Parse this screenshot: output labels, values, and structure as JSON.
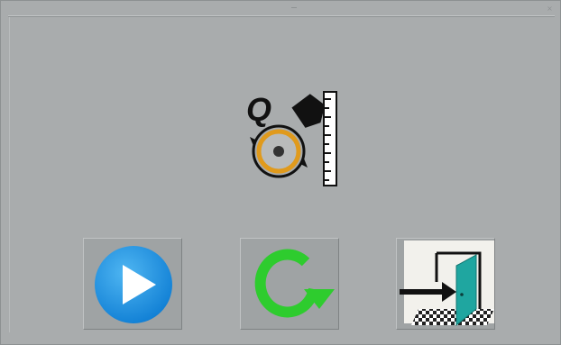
{
  "window": {
    "close_glyph": "×"
  },
  "logo": {
    "letter": "Q",
    "icon": "q-rotation-gauge-icon"
  },
  "buttons": [
    {
      "id": "play",
      "icon": "play-icon",
      "color": "#1e90df"
    },
    {
      "id": "reset",
      "icon": "rotate-arrow-icon",
      "color": "#2ecc2e"
    },
    {
      "id": "exit",
      "icon": "exit-door-icon",
      "color": "#1fa6a0"
    }
  ]
}
